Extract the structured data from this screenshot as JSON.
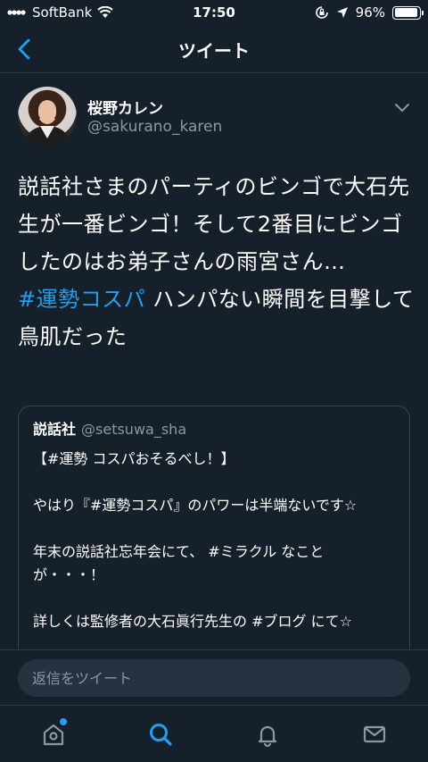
{
  "status_bar": {
    "carrier": "SoftBank",
    "time": "17:50",
    "battery": "96%",
    "battery_level": 0.96
  },
  "nav": {
    "title": "ツイート"
  },
  "tweet": {
    "display_name": "桜野カレン",
    "handle": "@sakurano_karen",
    "text_part1": "説話社さまのパーティのビンゴで大石先生が一番ビンゴ！そして2番目にビンゴしたのはお弟子さんの雨宮さん…",
    "hashtag": "#運勢コスパ",
    "text_part2": " ハンパない瞬間を目撃して鳥肌だった"
  },
  "quote": {
    "name": "説話社",
    "handle": "@setsuwa_sha",
    "line1": "【#運勢 コスパおそるべし！】",
    "line2": "やはり『#運勢コスパ』のパワーは半端ないです☆",
    "line3": "年末の説話社忘年会にて、 #ミラクル なことが・・・！",
    "line4": "詳しくは監修者の大石眞行先生の #ブログ にて☆"
  },
  "reply": {
    "placeholder": "返信をツイート"
  },
  "tabs": {
    "home": "home-icon",
    "search": "search-icon",
    "notifications": "bell-icon",
    "messages": "mail-icon"
  },
  "colors": {
    "background": "#15202b",
    "accent": "#1da1f2",
    "secondary_text": "#8899a6",
    "border": "#38444d"
  }
}
